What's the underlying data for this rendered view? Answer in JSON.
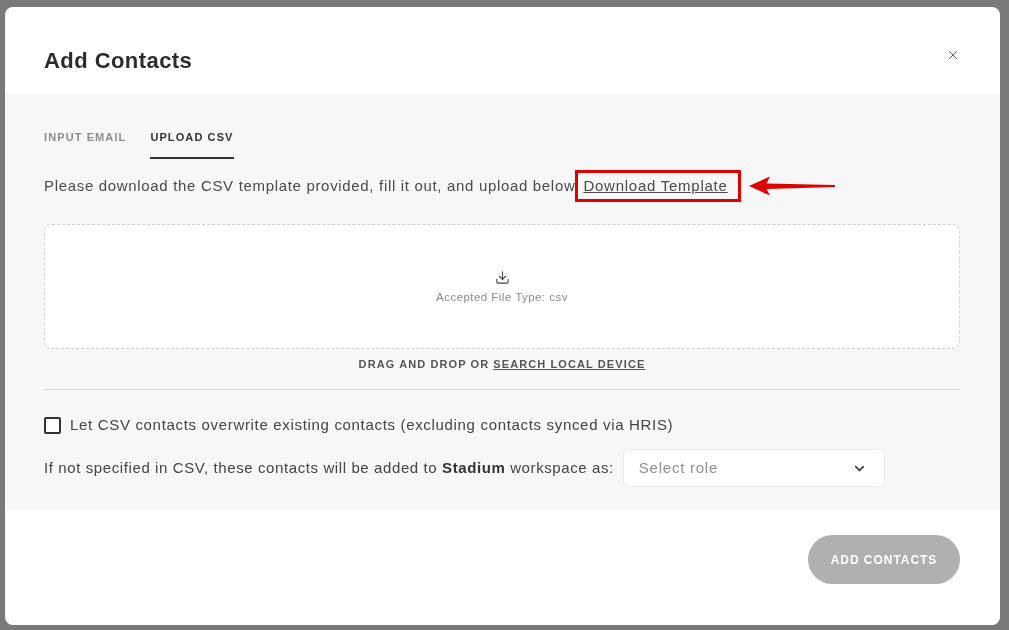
{
  "dialog": {
    "title": "Add Contacts"
  },
  "tabs": [
    {
      "label": "INPUT EMAIL",
      "selected": false
    },
    {
      "label": "UPLOAD CSV",
      "selected": true
    }
  ],
  "instructions": {
    "text": "Please download the CSV template provided, fill it out, and upload below",
    "link": "Download Template",
    "highlighted": true
  },
  "dropzone": {
    "caption": "Accepted File Type: csv",
    "prompt": "DRAG AND DROP OR",
    "link": "SEARCH LOCAL DEVICE"
  },
  "overwrite_option": {
    "label": "Let CSV contacts overwrite existing contacts (excluding contacts synced via HRIS)",
    "checked": false
  },
  "role_field": {
    "label": "If not specified in CSV, these contacts will be added to **Stadium** workspace as:",
    "placeholder": "Select role"
  },
  "submit_button": {
    "label": "ADD CONTACTS",
    "disabled": true
  }
}
